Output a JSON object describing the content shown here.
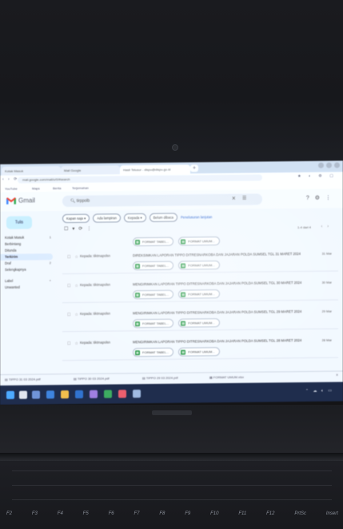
{
  "browser": {
    "tabs": [
      "Kotak Masuk",
      "Mail Google",
      "Hasil Telusur - dispu@dispu.go.id",
      "",
      ""
    ],
    "address": "mail.google.com/mail/u/0/#search",
    "bookmarks": [
      "YouTube",
      "Maps",
      "Berita",
      "Terjemahan"
    ]
  },
  "gmail": {
    "logo_text": "Gmail",
    "search_value": "tirppolb",
    "compose_label": "Tulis",
    "nav": [
      {
        "label": "Kotak Masuk",
        "count": "1",
        "active": false
      },
      {
        "label": "Berbintang",
        "count": "",
        "active": false
      },
      {
        "label": "Ditunda",
        "count": "",
        "active": false
      },
      {
        "label": "Terkirim",
        "count": "",
        "active": true
      },
      {
        "label": "Draf",
        "count": "2",
        "active": false
      },
      {
        "label": "Selengkapnya",
        "count": "",
        "active": false
      },
      {
        "label": "Label",
        "count": "+",
        "active": false
      },
      {
        "label": "Unwanted",
        "count": "",
        "active": false
      }
    ],
    "chips": [
      "Kapan saja ▾",
      "Ada lampiran",
      "Kepada ▾",
      "Belum dibaca"
    ],
    "advanced_search_link": "Penelusuran lanjutan",
    "pagination": "1-4 dari 4",
    "emails": [
      {
        "sender": "Kepada: tiktmapolsn",
        "subject": "DIREKSIMKAN LAPORAN TIPPO DITRESNARKOBA DAN JAJARAN POLDA SUMSEL TGL 31 MARET 2024",
        "time": "31 Mar",
        "attachments": [
          "FORMAT TABEL...",
          "FORMAT UMUM..."
        ]
      },
      {
        "sender": "Kepada: tiktmapolsn",
        "subject": "MENGIRIMKAN LAPORAN TIPPO DITRESNARKOBA DAN JAJARAN POLDA SUMSEL TGL 30 MARET 2024",
        "time": "30 Mar",
        "attachments": [
          "FORMAT TABEL...",
          "FORMAT UMUM..."
        ]
      },
      {
        "sender": "Kepada: tiktmapolsn",
        "subject": "MENGIRIMKAN LAPORAN TIPPO DITRESNARKOBA DAN JAJARAN POLDA SUMSEL TGL 29 MARET 2024",
        "time": "29 Mar",
        "attachments": [
          "FORMAT TABEL...",
          "FORMAT UMUM..."
        ]
      },
      {
        "sender": "Kepada: tiktmapolsn",
        "subject": "MENGIRIMKAN LAPORAN TIPPO DITRESNARKOBA DAN JAJARAN POLDA SUMSEL TGL 28 MARET 2024",
        "time": "28 Mar",
        "attachments": [
          "FORMAT TABEL...",
          "FORMAT UMUM..."
        ]
      }
    ],
    "first_row_attachments": [
      "FORMAT TABEL...",
      "FORMAT UMUM..."
    ]
  },
  "downloads": [
    "TIPPO 31 03 2024.pdf",
    "TIPPO 30 03 2024.pdf",
    "TIPPO 29 03 2024.pdf",
    "FORMAT UMUM.xlsx"
  ],
  "keyboard": {
    "fkeys": [
      "F2",
      "F3",
      "F4",
      "F5",
      "F6",
      "F7",
      "F8",
      "F9",
      "F10",
      "F11",
      "F12",
      "PrtSc",
      "Insert"
    ]
  },
  "colors": {
    "compose_bg": "#c2e7ff",
    "nav_active_bg": "#d3e3fd",
    "taskbar_bg": "#1e2b4a",
    "attachment_green": "#1e8e3e"
  }
}
